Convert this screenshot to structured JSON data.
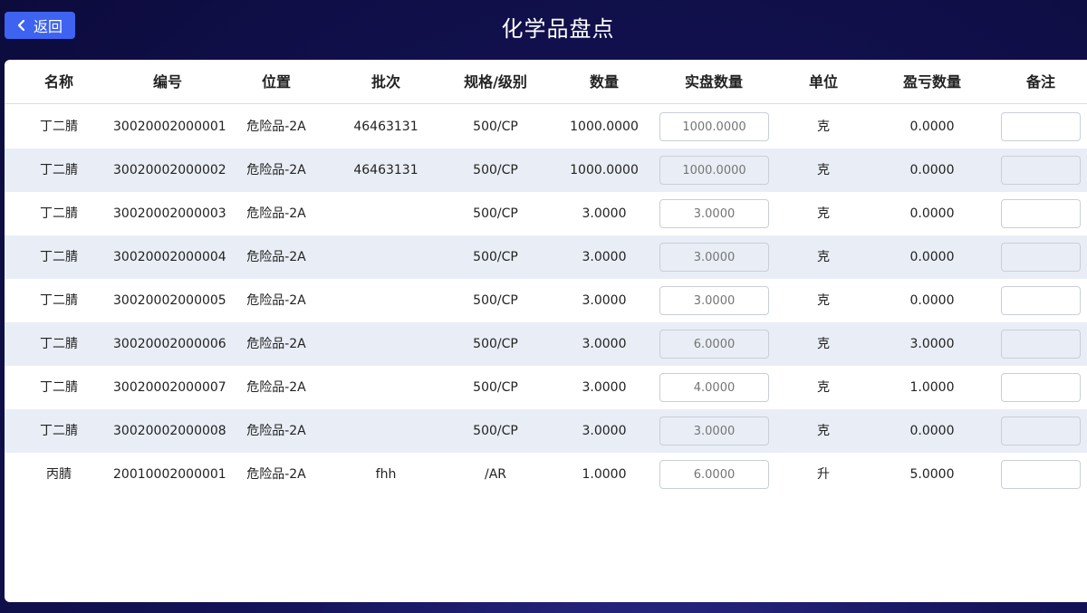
{
  "header": {
    "back_label": "返回",
    "title": "化学品盘点"
  },
  "table": {
    "columns": [
      "名称",
      "编号",
      "位置",
      "批次",
      "规格/级别",
      "数量",
      "实盘数量",
      "单位",
      "盈亏数量",
      "备注"
    ],
    "rows": [
      {
        "name": "丁二腈",
        "code": "30020002000001",
        "location": "危险品-2A",
        "batch": "46463131",
        "spec": "500/CP",
        "qty": "1000.0000",
        "actual": "1000.0000",
        "unit": "克",
        "diff": "0.0000",
        "remark": ""
      },
      {
        "name": "丁二腈",
        "code": "30020002000002",
        "location": "危险品-2A",
        "batch": "46463131",
        "spec": "500/CP",
        "qty": "1000.0000",
        "actual": "1000.0000",
        "unit": "克",
        "diff": "0.0000",
        "remark": ""
      },
      {
        "name": "丁二腈",
        "code": "30020002000003",
        "location": "危险品-2A",
        "batch": "",
        "spec": "500/CP",
        "qty": "3.0000",
        "actual": "3.0000",
        "unit": "克",
        "diff": "0.0000",
        "remark": ""
      },
      {
        "name": "丁二腈",
        "code": "30020002000004",
        "location": "危险品-2A",
        "batch": "",
        "spec": "500/CP",
        "qty": "3.0000",
        "actual": "3.0000",
        "unit": "克",
        "diff": "0.0000",
        "remark": ""
      },
      {
        "name": "丁二腈",
        "code": "30020002000005",
        "location": "危险品-2A",
        "batch": "",
        "spec": "500/CP",
        "qty": "3.0000",
        "actual": "3.0000",
        "unit": "克",
        "diff": "0.0000",
        "remark": ""
      },
      {
        "name": "丁二腈",
        "code": "30020002000006",
        "location": "危险品-2A",
        "batch": "",
        "spec": "500/CP",
        "qty": "3.0000",
        "actual": "6.0000",
        "unit": "克",
        "diff": "3.0000",
        "remark": ""
      },
      {
        "name": "丁二腈",
        "code": "30020002000007",
        "location": "危险品-2A",
        "batch": "",
        "spec": "500/CP",
        "qty": "3.0000",
        "actual": "4.0000",
        "unit": "克",
        "diff": "1.0000",
        "remark": ""
      },
      {
        "name": "丁二腈",
        "code": "30020002000008",
        "location": "危险品-2A",
        "batch": "",
        "spec": "500/CP",
        "qty": "3.0000",
        "actual": "3.0000",
        "unit": "克",
        "diff": "0.0000",
        "remark": ""
      },
      {
        "name": "丙腈",
        "code": "20010002000001",
        "location": "危险品-2A",
        "batch": "fhh",
        "spec": "/AR",
        "qty": "1.0000",
        "actual": "6.0000",
        "unit": "升",
        "diff": "5.0000",
        "remark": ""
      }
    ]
  },
  "colors": {
    "accent": "#3d63f0",
    "stripe": "#e9eef6",
    "background": "#0c0b3c"
  }
}
